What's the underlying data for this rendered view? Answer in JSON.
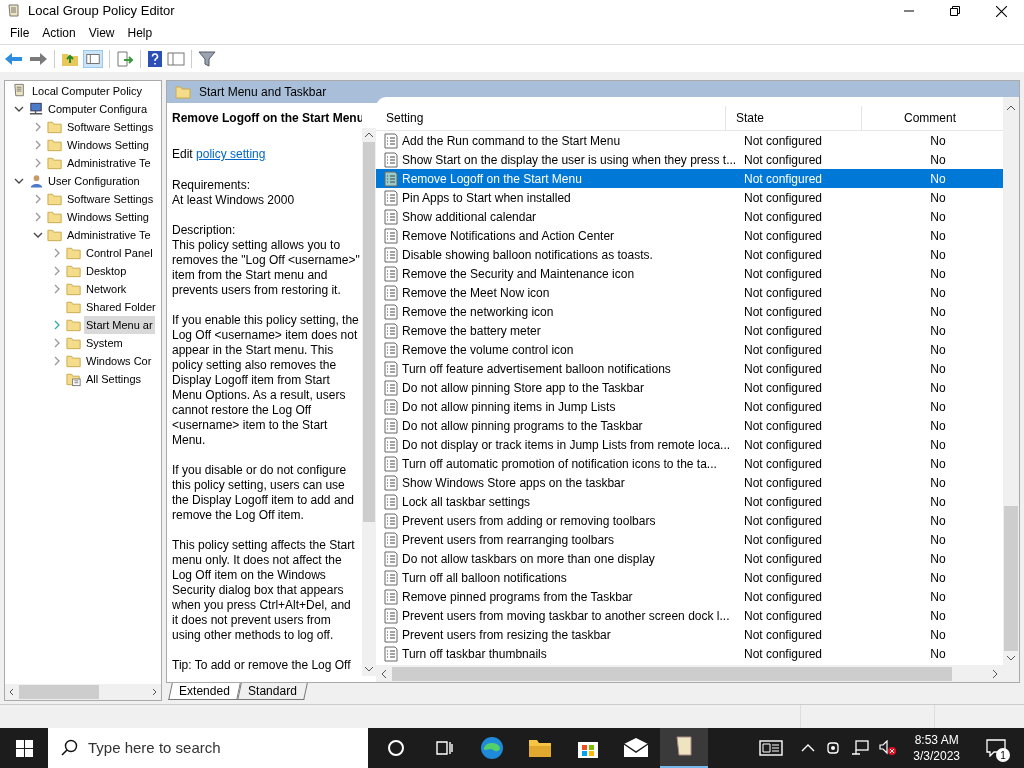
{
  "window": {
    "title": "Local Group Policy Editor"
  },
  "menu": [
    "File",
    "Action",
    "View",
    "Help"
  ],
  "tree": [
    {
      "label": "Local Computer Policy",
      "kind": "scroll",
      "selected": false,
      "children": [
        {
          "label": "Computer Configura",
          "kind": "computer",
          "expanded": true,
          "selected": false,
          "children": [
            {
              "label": "Software Settings",
              "kind": "folder",
              "expanded": false,
              "selected": false
            },
            {
              "label": "Windows Setting",
              "kind": "folder",
              "expanded": false,
              "selected": false
            },
            {
              "label": "Administrative Te",
              "kind": "folder",
              "expanded": false,
              "selected": false
            }
          ]
        },
        {
          "label": "User Configuration",
          "kind": "user",
          "expanded": true,
          "selected": false,
          "children": [
            {
              "label": "Software Settings",
              "kind": "folder",
              "expanded": false,
              "selected": false
            },
            {
              "label": "Windows Setting",
              "kind": "folder",
              "expanded": false,
              "selected": false
            },
            {
              "label": "Administrative Te",
              "kind": "folder",
              "expanded": true,
              "selected": false,
              "children": [
                {
                  "label": "Control Panel",
                  "kind": "folder",
                  "expanded": false,
                  "selected": false
                },
                {
                  "label": "Desktop",
                  "kind": "folder",
                  "expanded": false,
                  "selected": false
                },
                {
                  "label": "Network",
                  "kind": "folder",
                  "expanded": false,
                  "selected": false
                },
                {
                  "label": "Shared Folder",
                  "kind": "folder",
                  "selected": false
                },
                {
                  "label": "Start Menu ar",
                  "kind": "folder",
                  "expanded": false,
                  "selected": true
                },
                {
                  "label": "System",
                  "kind": "folder",
                  "expanded": false,
                  "selected": false
                },
                {
                  "label": "Windows Cor",
                  "kind": "folder",
                  "expanded": false,
                  "selected": false
                },
                {
                  "label": "All Settings",
                  "kind": "settings",
                  "selected": false
                }
              ]
            }
          ]
        }
      ]
    }
  ],
  "details": {
    "folder": "Start Menu and Taskbar",
    "title": "Remove Logoff on the Start Menu",
    "edit_prefix": "Edit",
    "edit_link": "policy setting",
    "paragraphs": [
      "Requirements:\nAt least Windows 2000",
      "Description:\nThis policy setting allows you to removes the \"Log Off <username>\" item from the Start menu and prevents users from restoring it.",
      "If you enable this policy setting, the Log Off <username> item does not appear in the Start menu. This policy setting also removes the Display Logoff item from Start Menu Options. As a result, users cannot restore the Log Off <username> item to the Start Menu.",
      "If you disable or do not configure this policy setting, users can use the Display Logoff item to add and remove the Log Off item.",
      "This policy setting affects the Start menu only. It does not affect the Log Off item on the Windows Security dialog box that appears when you press Ctrl+Alt+Del, and it does not prevent users from using other methods to log off.",
      "Tip: To add or remove the Log Off"
    ]
  },
  "table": {
    "columns": [
      "Setting",
      "State",
      "Comment"
    ],
    "rows": [
      {
        "setting": "Add the Run command to the Start Menu",
        "state": "Not configured",
        "comment": "No",
        "selected": false
      },
      {
        "setting": "Show Start on the display the user is using when they press t...",
        "state": "Not configured",
        "comment": "No",
        "selected": false
      },
      {
        "setting": "Remove Logoff on the Start Menu",
        "state": "Not configured",
        "comment": "No",
        "selected": true
      },
      {
        "setting": "Pin Apps to Start when installed",
        "state": "Not configured",
        "comment": "No",
        "selected": false
      },
      {
        "setting": "Show additional calendar",
        "state": "Not configured",
        "comment": "No",
        "selected": false
      },
      {
        "setting": "Remove Notifications and Action Center",
        "state": "Not configured",
        "comment": "No",
        "selected": false
      },
      {
        "setting": "Disable showing balloon notifications as toasts.",
        "state": "Not configured",
        "comment": "No",
        "selected": false
      },
      {
        "setting": "Remove the Security and Maintenance icon",
        "state": "Not configured",
        "comment": "No",
        "selected": false
      },
      {
        "setting": "Remove the Meet Now icon",
        "state": "Not configured",
        "comment": "No",
        "selected": false
      },
      {
        "setting": "Remove the networking icon",
        "state": "Not configured",
        "comment": "No",
        "selected": false
      },
      {
        "setting": "Remove the battery meter",
        "state": "Not configured",
        "comment": "No",
        "selected": false
      },
      {
        "setting": "Remove the volume control icon",
        "state": "Not configured",
        "comment": "No",
        "selected": false
      },
      {
        "setting": "Turn off feature advertisement balloon notifications",
        "state": "Not configured",
        "comment": "No",
        "selected": false
      },
      {
        "setting": "Do not allow pinning Store app to the Taskbar",
        "state": "Not configured",
        "comment": "No",
        "selected": false
      },
      {
        "setting": "Do not allow pinning items in Jump Lists",
        "state": "Not configured",
        "comment": "No",
        "selected": false
      },
      {
        "setting": "Do not allow pinning programs to the Taskbar",
        "state": "Not configured",
        "comment": "No",
        "selected": false
      },
      {
        "setting": "Do not display or track items in Jump Lists from remote loca...",
        "state": "Not configured",
        "comment": "No",
        "selected": false
      },
      {
        "setting": "Turn off automatic promotion of notification icons to the ta...",
        "state": "Not configured",
        "comment": "No",
        "selected": false
      },
      {
        "setting": "Show Windows Store apps on the taskbar",
        "state": "Not configured",
        "comment": "No",
        "selected": false
      },
      {
        "setting": "Lock all taskbar settings",
        "state": "Not configured",
        "comment": "No",
        "selected": false
      },
      {
        "setting": "Prevent users from adding or removing toolbars",
        "state": "Not configured",
        "comment": "No",
        "selected": false
      },
      {
        "setting": "Prevent users from rearranging toolbars",
        "state": "Not configured",
        "comment": "No",
        "selected": false
      },
      {
        "setting": "Do not allow taskbars on more than one display",
        "state": "Not configured",
        "comment": "No",
        "selected": false
      },
      {
        "setting": "Turn off all balloon notifications",
        "state": "Not configured",
        "comment": "No",
        "selected": false
      },
      {
        "setting": "Remove pinned programs from the Taskbar",
        "state": "Not configured",
        "comment": "No",
        "selected": false
      },
      {
        "setting": "Prevent users from moving taskbar to another screen dock l...",
        "state": "Not configured",
        "comment": "No",
        "selected": false
      },
      {
        "setting": "Prevent users from resizing the taskbar",
        "state": "Not configured",
        "comment": "No",
        "selected": false
      },
      {
        "setting": "Turn off taskbar thumbnails",
        "state": "Not configured",
        "comment": "No",
        "selected": false
      }
    ]
  },
  "view_tabs": [
    {
      "label": "Extended",
      "selected": true
    },
    {
      "label": "Standard",
      "selected": false
    }
  ],
  "taskbar": {
    "search_placeholder": "Type here to search",
    "time": "8:53 AM",
    "date": "3/3/2023",
    "notifications": "1"
  }
}
